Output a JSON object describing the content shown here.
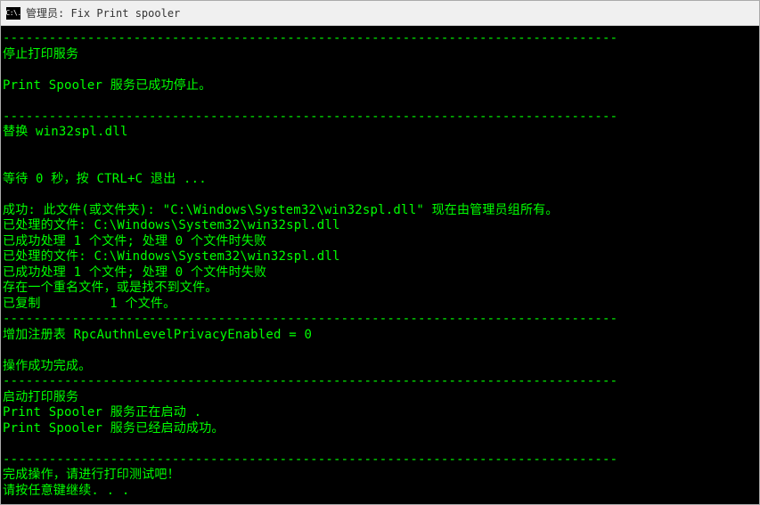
{
  "window": {
    "icon_text": "C:\\.",
    "title": "管理员:  Fix Print spooler"
  },
  "terminal": {
    "lines": [
      "--------------------------------------------------------------------------------",
      "停止打印服务",
      "",
      "Print Spooler 服务已成功停止。",
      "",
      "--------------------------------------------------------------------------------",
      "替换 win32spl.dll",
      "",
      "",
      "等待 0 秒，按 CTRL+C 退出 ...",
      "",
      "成功: 此文件(或文件夹): \"C:\\Windows\\System32\\win32spl.dll\" 现在由管理员组所有。",
      "已处理的文件: C:\\Windows\\System32\\win32spl.dll",
      "已成功处理 1 个文件; 处理 0 个文件时失败",
      "已处理的文件: C:\\Windows\\System32\\win32spl.dll",
      "已成功处理 1 个文件; 处理 0 个文件时失败",
      "存在一个重名文件，或是找不到文件。",
      "已复制         1 个文件。",
      "--------------------------------------------------------------------------------",
      "增加注册表 RpcAuthnLevelPrivacyEnabled = 0",
      "",
      "操作成功完成。",
      "--------------------------------------------------------------------------------",
      "启动打印服务",
      "Print Spooler 服务正在启动 .",
      "Print Spooler 服务已经启动成功。",
      "",
      "--------------------------------------------------------------------------------",
      "完成操作，请进行打印测试吧！",
      "请按任意键继续. . ."
    ]
  }
}
